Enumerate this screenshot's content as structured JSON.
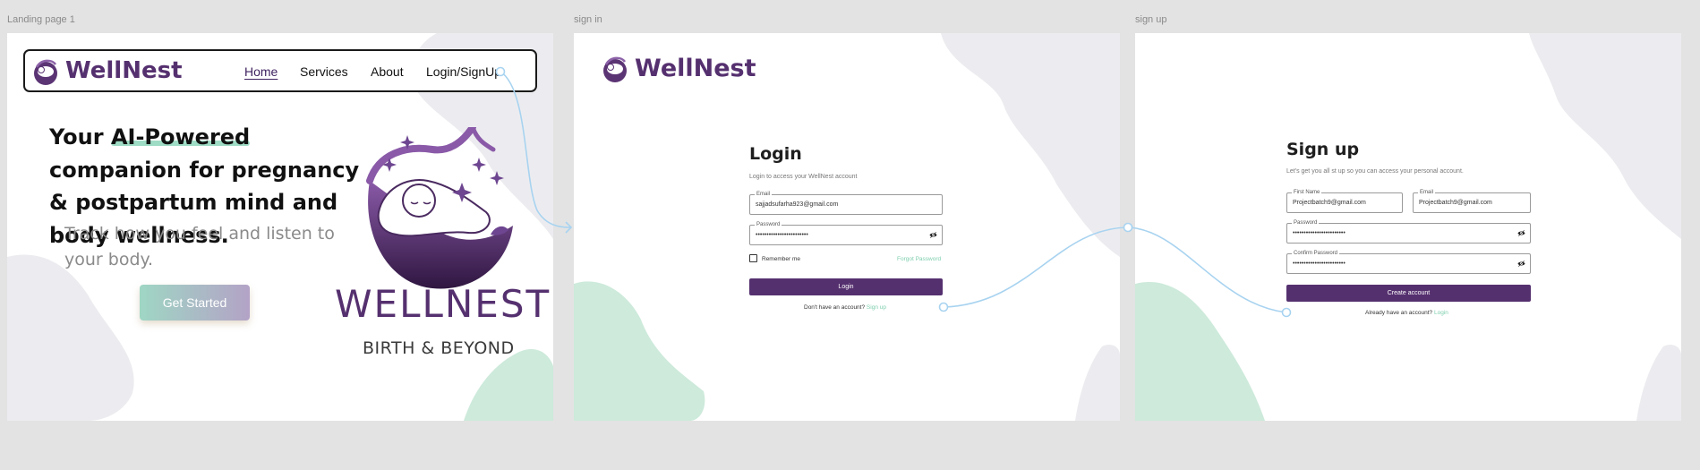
{
  "frames": {
    "landing_label": "Landing page 1",
    "signin_label": "sign in",
    "signup_label": "sign up"
  },
  "landing": {
    "logo_text": "WellNest",
    "nav": {
      "home": "Home",
      "services": "Services",
      "about": "About",
      "login_signup": "Login/SignUp"
    },
    "hero_prefix": "Your ",
    "hero_highlight": "AI-Powered",
    "hero_rest": " companion for pregnancy & postpartum mind and body wellness.",
    "subtitle": "Track how you feel and listen to your body.",
    "cta": "Get Started",
    "brand_name": "WELLNEST",
    "brand_tagline": "BIRTH & BEYOND"
  },
  "login": {
    "logo_text": "WellNest",
    "title": "Login",
    "subtitle": "Login to access your WellNest  account",
    "email_label": "Email",
    "email_value": "sajjadsufarha923@gmail.com",
    "password_label": "Password",
    "password_value": "••••••••••••••••••••••••",
    "remember_me": "Remember me",
    "forgot_password": "Forgot Password",
    "button": "Login",
    "no_account": "Don't have an account?",
    "signup_link": "Sign up"
  },
  "signup": {
    "title": "Sign up",
    "subtitle": "Let's get you all st up so you can access your personal account.",
    "first_name_label": "First Name",
    "first_name_value": "Projectbatch9@gmail.com",
    "email_label": "Email",
    "email_value": "Projectbatch9@gmail.com",
    "password_label": "Password",
    "password_value": "••••••••••••••••••••••••",
    "confirm_label": "Confirm Password",
    "confirm_value": "••••••••••••••••••••••••",
    "button": "Create account",
    "have_account": "Already have an account?",
    "login_link": "Login"
  },
  "colors": {
    "brand_purple": "#55306f",
    "mint": "#cdeadb",
    "gray_blob": "#ececf0",
    "connector": "#a8d3f0"
  }
}
